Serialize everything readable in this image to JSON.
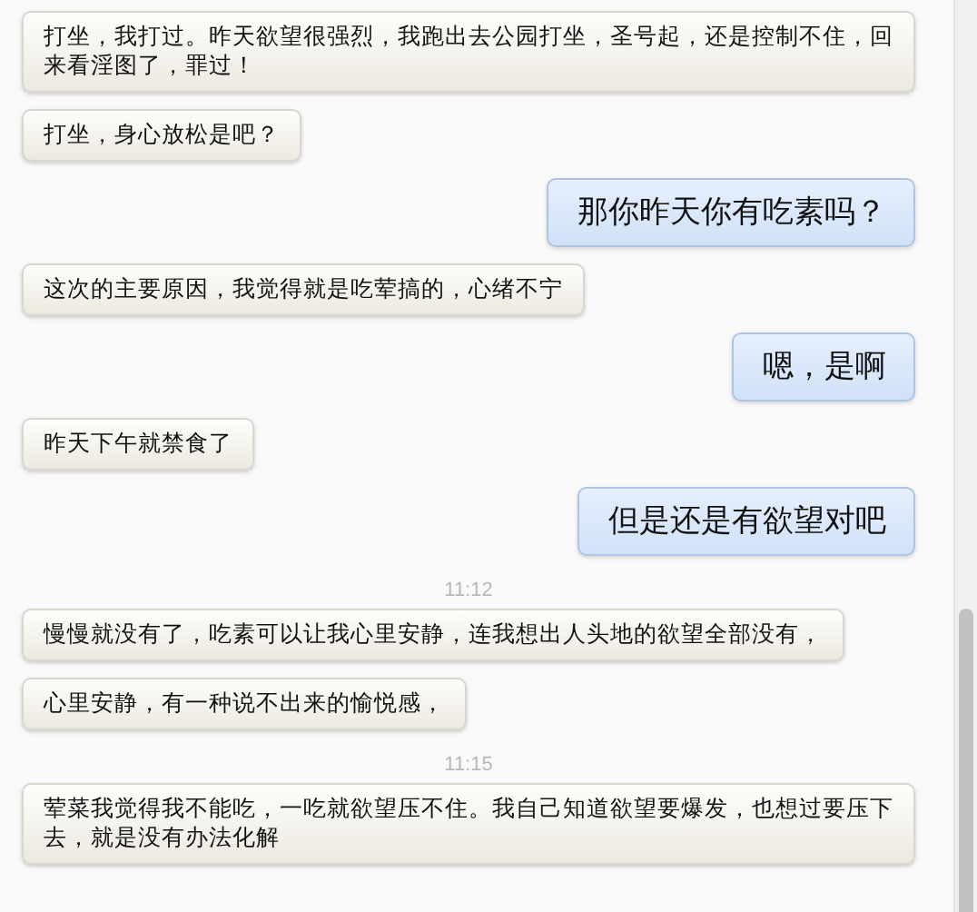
{
  "messages": [
    {
      "kind": "incoming",
      "text": "打坐，我打过。昨天欲望很强烈，我跑出去公园打坐，圣号起，还是控制不住，回来看淫图了，罪过！"
    },
    {
      "kind": "incoming",
      "text": "打坐，身心放松是吧？"
    },
    {
      "kind": "outgoing",
      "text": "那你昨天你有吃素吗？"
    },
    {
      "kind": "incoming",
      "text": "这次的主要原因，我觉得就是吃荤搞的，心绪不宁"
    },
    {
      "kind": "outgoing",
      "text": "嗯，是啊"
    },
    {
      "kind": "incoming",
      "text": "昨天下午就禁食了"
    },
    {
      "kind": "outgoing",
      "text": "但是还是有欲望对吧"
    },
    {
      "kind": "time",
      "text": "11:12"
    },
    {
      "kind": "incoming",
      "text": "慢慢就没有了，吃素可以让我心里安静，连我想出人头地的欲望全部没有，"
    },
    {
      "kind": "incoming",
      "text": "心里安静，有一种说不出来的愉悦感，"
    },
    {
      "kind": "time",
      "text": "11:15"
    },
    {
      "kind": "incoming",
      "text": "荤菜我觉得我不能吃，一吃就欲望压不住。我自己知道欲望要爆发，也想过要压下去，就是没有办法化解"
    }
  ]
}
